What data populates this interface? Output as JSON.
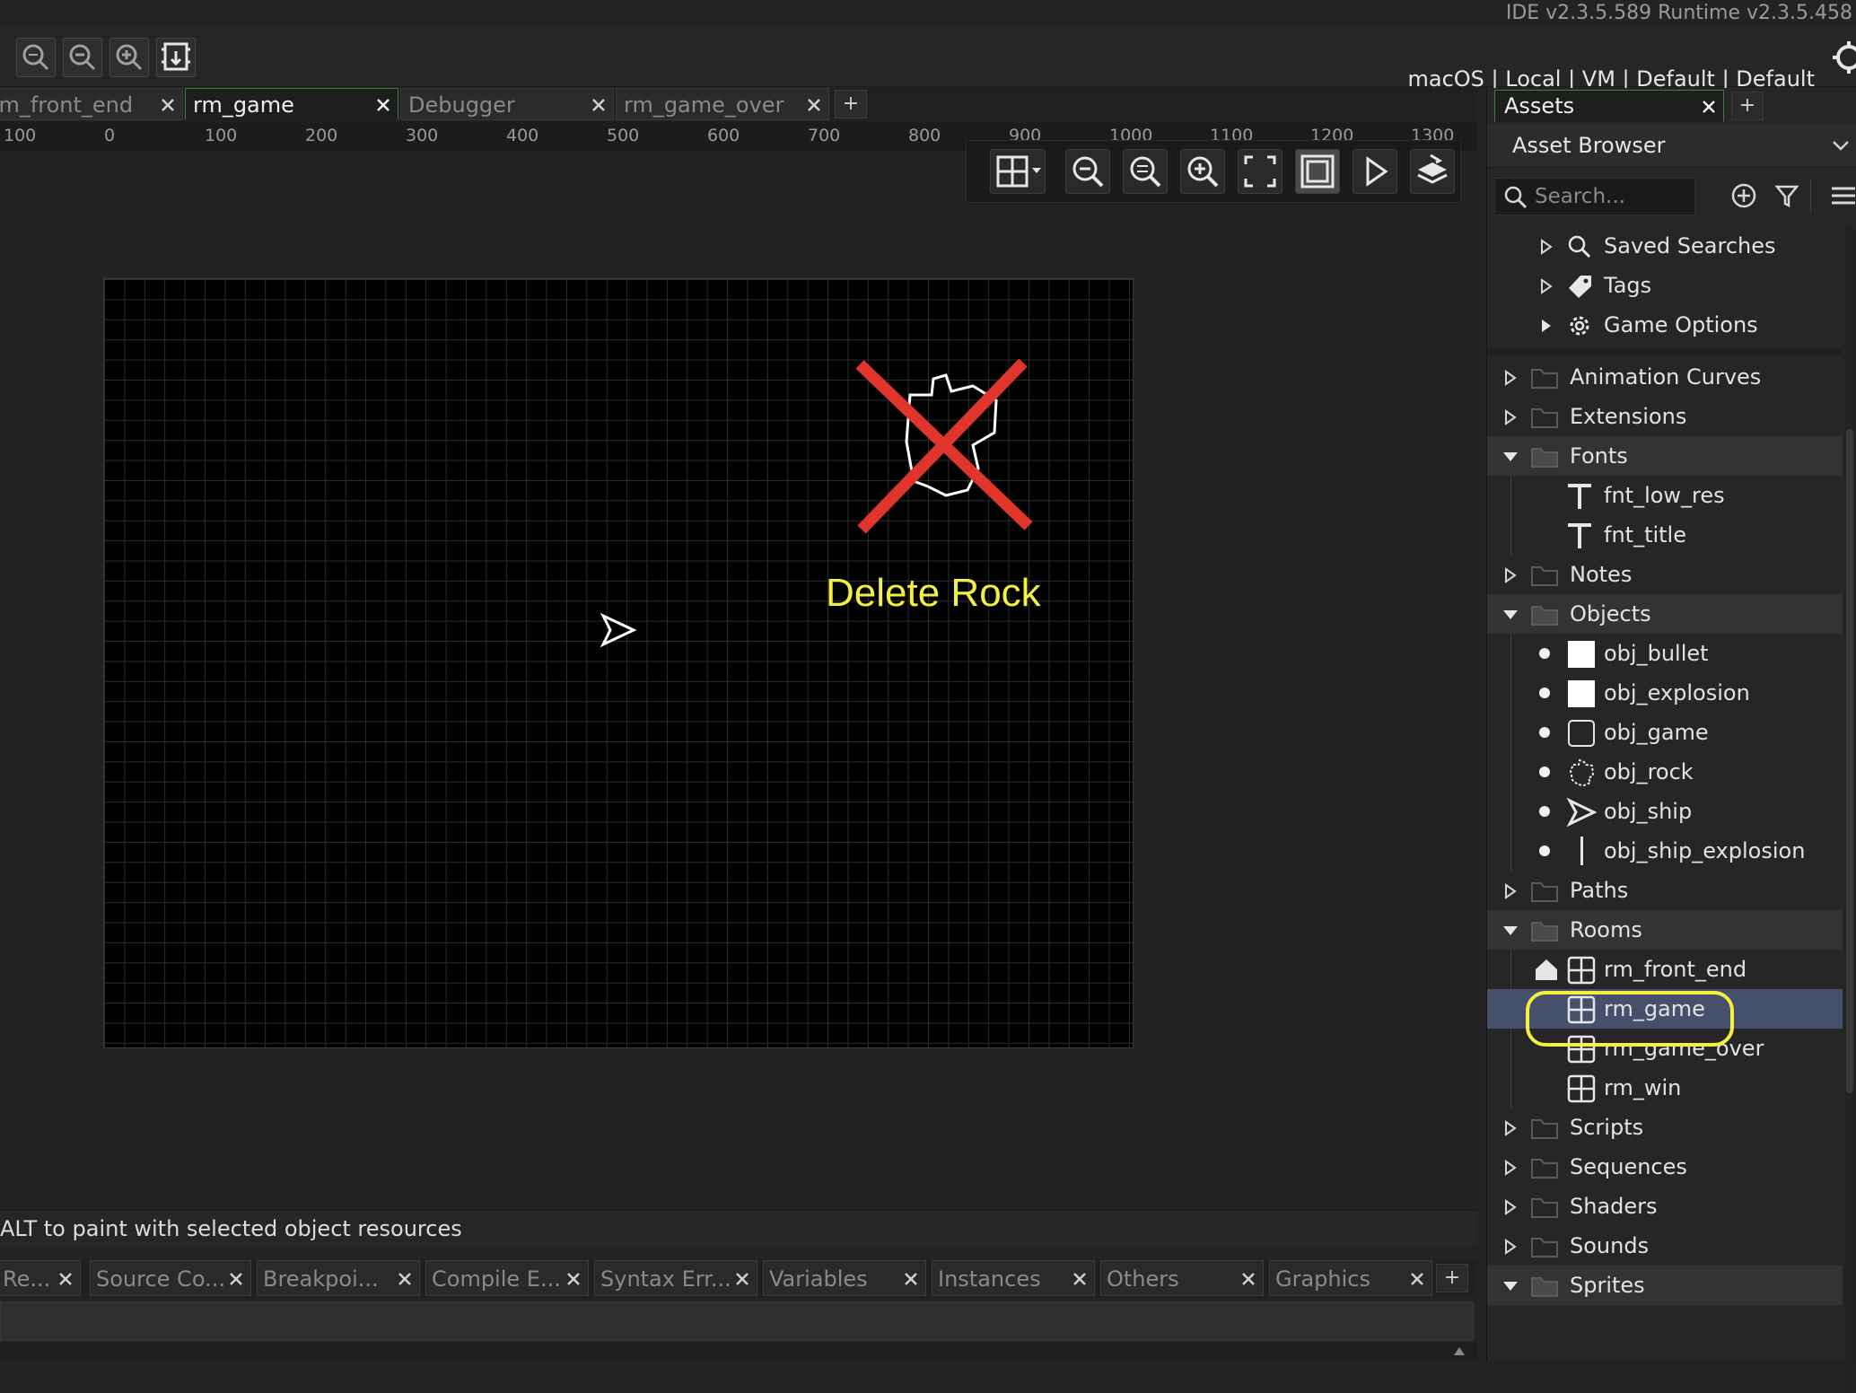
{
  "app": {
    "version_text": "IDE v2.3.5.589  Runtime v2.3.5.458"
  },
  "toolbar": {
    "target_text": "macOS | Local | VM | Default | Default",
    "buttons": [
      {
        "name": "zoom-reset-icon"
      },
      {
        "name": "zoom-out-icon"
      },
      {
        "name": "zoom-in-icon"
      },
      {
        "name": "device-icon"
      }
    ]
  },
  "editor_tabs": [
    {
      "label": "rm_front_end",
      "active": false
    },
    {
      "label": "rm_game",
      "active": true
    },
    {
      "label": "Debugger",
      "active": false
    },
    {
      "label": "rm_game_over",
      "active": false
    }
  ],
  "ruler": {
    "labels": [
      "100",
      "0",
      "100",
      "200",
      "300",
      "400",
      "500",
      "600",
      "700",
      "800",
      "900",
      "1000",
      "1100",
      "1200",
      "1300"
    ]
  },
  "room_toolbar": {
    "buttons": [
      "grid-icon",
      "zoom-out-icon",
      "zoom-reset-icon",
      "zoom-in-icon",
      "fullscreen-icon",
      "frame-icon",
      "play-icon",
      "layers-icon"
    ]
  },
  "room": {
    "overlay_text": "Delete Rock"
  },
  "status": {
    "hint": "ALT to paint with selected object resources"
  },
  "bottom_tabs": [
    {
      "label": "Re..."
    },
    {
      "label": "Source Co..."
    },
    {
      "label": "Breakpoi..."
    },
    {
      "label": "Compile E..."
    },
    {
      "label": "Syntax Err..."
    },
    {
      "label": "Variables"
    },
    {
      "label": "Instances"
    },
    {
      "label": "Others"
    },
    {
      "label": "Graphics"
    }
  ],
  "assets_panel": {
    "tab_label": "Assets",
    "browser_title": "Asset Browser",
    "search_placeholder": "Search...",
    "tree": [
      {
        "label": "Saved Searches",
        "indent": 1,
        "icon": "search-icon",
        "toggle": "collapsed"
      },
      {
        "label": "Tags",
        "indent": 1,
        "icon": "tag-icon",
        "toggle": "collapsed"
      },
      {
        "label": "Game Options",
        "indent": 1,
        "icon": "gear-icon",
        "toggle": "collapsed-filled"
      },
      {
        "label": "Animation Curves",
        "indent": 0,
        "icon": "folder-icon",
        "toggle": "collapsed"
      },
      {
        "label": "Extensions",
        "indent": 0,
        "icon": "folder-icon",
        "toggle": "collapsed"
      },
      {
        "label": "Fonts",
        "indent": 0,
        "icon": "folder-icon",
        "toggle": "expanded"
      },
      {
        "label": "fnt_low_res",
        "indent": 1,
        "icon": "font-icon"
      },
      {
        "label": "fnt_title",
        "indent": 1,
        "icon": "font-icon"
      },
      {
        "label": "Notes",
        "indent": 0,
        "icon": "folder-icon",
        "toggle": "collapsed"
      },
      {
        "label": "Objects",
        "indent": 0,
        "icon": "folder-icon",
        "toggle": "expanded"
      },
      {
        "label": "obj_bullet",
        "indent": 1,
        "icon": "white-square-icon",
        "bullet": true
      },
      {
        "label": "obj_explosion",
        "indent": 1,
        "icon": "white-square-icon",
        "bullet": true
      },
      {
        "label": "obj_game",
        "indent": 1,
        "icon": "outline-square-icon",
        "bullet": true
      },
      {
        "label": "obj_rock",
        "indent": 1,
        "icon": "rock-icon",
        "bullet": true
      },
      {
        "label": "obj_ship",
        "indent": 1,
        "icon": "ship-icon",
        "bullet": true
      },
      {
        "label": "obj_ship_explosion",
        "indent": 1,
        "icon": "line-icon",
        "bullet": true
      },
      {
        "label": "Paths",
        "indent": 0,
        "icon": "folder-icon",
        "toggle": "collapsed"
      },
      {
        "label": "Rooms",
        "indent": 0,
        "icon": "folder-icon",
        "toggle": "expanded"
      },
      {
        "label": "rm_front_end",
        "indent": 1,
        "icon": "room-icon",
        "home": true
      },
      {
        "label": "rm_game",
        "indent": 1,
        "icon": "room-icon",
        "selected": true
      },
      {
        "label": "rm_game_over",
        "indent": 1,
        "icon": "room-icon"
      },
      {
        "label": "rm_win",
        "indent": 1,
        "icon": "room-icon"
      },
      {
        "label": "Scripts",
        "indent": 0,
        "icon": "folder-icon",
        "toggle": "collapsed"
      },
      {
        "label": "Sequences",
        "indent": 0,
        "icon": "folder-icon",
        "toggle": "collapsed"
      },
      {
        "label": "Shaders",
        "indent": 0,
        "icon": "folder-icon",
        "toggle": "collapsed"
      },
      {
        "label": "Sounds",
        "indent": 0,
        "icon": "folder-icon",
        "toggle": "collapsed"
      },
      {
        "label": "Sprites",
        "indent": 0,
        "icon": "folder-icon",
        "toggle": "expanded"
      }
    ]
  },
  "colors": {
    "accent_green": "#3f7d3f",
    "selection": "#46506a",
    "highlight_yellow": "#f4f040",
    "delete_red": "#e0352a"
  }
}
